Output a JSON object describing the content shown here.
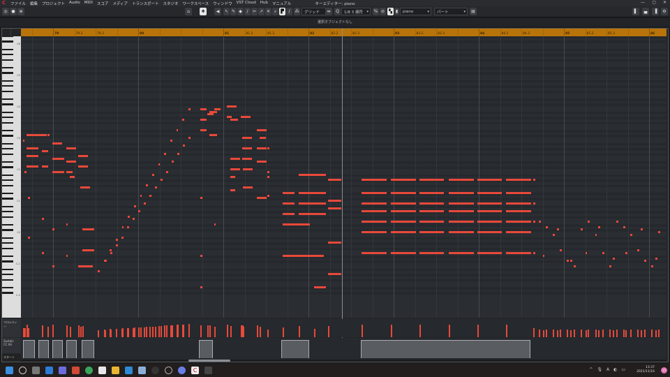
{
  "window": {
    "title": "キーエディター: piano",
    "status": "選択オブジェクトなし"
  },
  "menu": [
    "ファイル",
    "編集",
    "プロジェクト",
    "Audio",
    "MIDI",
    "スコア",
    "メディア",
    "トランスポート",
    "スタジオ",
    "ワークスペース",
    "ウィンドウ",
    "VST Cloud",
    "Hub",
    "マニュアル"
  ],
  "toolbar": {
    "snap_type": "グリッド",
    "quantize": "1/8  3 連符",
    "track": "piano",
    "part": "パート"
  },
  "ruler": [
    {
      "label": "79",
      "bar": 79,
      "beat": 1
    },
    {
      "label": "79.2",
      "bar": 79,
      "beat": 2
    },
    {
      "label": "79.3",
      "bar": 79,
      "beat": 3
    },
    {
      "label": "80",
      "bar": 80,
      "beat": 1
    },
    {
      "label": "81",
      "bar": 81,
      "beat": 1
    },
    {
      "label": "81.2",
      "bar": 81,
      "beat": 2
    },
    {
      "label": "81.3",
      "bar": 81,
      "beat": 3
    },
    {
      "label": "82",
      "bar": 82,
      "beat": 1
    },
    {
      "label": "82.2",
      "bar": 82,
      "beat": 2
    },
    {
      "label": "82.3",
      "bar": 82,
      "beat": 3
    },
    {
      "label": "83",
      "bar": 83,
      "beat": 1
    },
    {
      "label": "83.2",
      "bar": 83,
      "beat": 2
    },
    {
      "label": "83.3",
      "bar": 83,
      "beat": 3
    },
    {
      "label": "84",
      "bar": 84,
      "beat": 1
    },
    {
      "label": "84.2",
      "bar": 84,
      "beat": 2
    },
    {
      "label": "84.3",
      "bar": 84,
      "beat": 3
    },
    {
      "label": "85",
      "bar": 85,
      "beat": 1
    },
    {
      "label": "85.2",
      "bar": 85,
      "beat": 2
    },
    {
      "label": "85.3",
      "bar": 85,
      "beat": 3
    },
    {
      "label": "86",
      "bar": 86,
      "beat": 1
    }
  ],
  "lanes": {
    "velocity_label": "ベロシティー",
    "sustain_label": "Sustain",
    "sustain_cc": "CC 64",
    "start_label": "スタート"
  },
  "notes_format": "[start_beat_from_bar79, length_beats, midi_pitch, velocity]",
  "notes": [
    [
      -1.25,
      0.98,
      61,
      95
    ],
    [
      -0.26,
      0.13,
      61,
      80
    ],
    [
      -1.41,
      0.1,
      59,
      70
    ],
    [
      -1.25,
      0.59,
      56,
      90
    ],
    [
      -1.25,
      0.59,
      53,
      85
    ],
    [
      -1.25,
      0.59,
      49,
      85
    ],
    [
      -0.52,
      0.33,
      55,
      90
    ],
    [
      -0.52,
      0.33,
      49,
      80
    ],
    [
      -0.03,
      0.49,
      58,
      95
    ],
    [
      -0.03,
      0.59,
      52,
      90
    ],
    [
      -0.03,
      0.59,
      47,
      85
    ],
    [
      0.62,
      0.49,
      56,
      90
    ],
    [
      0.62,
      0.49,
      51,
      85
    ],
    [
      0.62,
      0.33,
      47,
      80
    ],
    [
      0.79,
      0.26,
      45,
      80
    ],
    [
      1.18,
      0.49,
      53,
      90
    ],
    [
      1.18,
      0.49,
      49,
      85
    ],
    [
      1.28,
      0.49,
      41,
      80
    ],
    [
      -1.34,
      0.1,
      47,
      70
    ],
    [
      -1.18,
      0.1,
      37,
      70
    ],
    [
      -1.18,
      0.1,
      22,
      70
    ],
    [
      -0.52,
      0.1,
      29,
      70
    ],
    [
      -0.52,
      0.1,
      16,
      70
    ],
    [
      -0.03,
      0.1,
      25,
      70
    ],
    [
      -0.03,
      0.1,
      11,
      70
    ],
    [
      0.62,
      0.1,
      27,
      70
    ],
    [
      0.62,
      0.1,
      15,
      70
    ],
    [
      1.18,
      0.72,
      11,
      80
    ],
    [
      1.38,
      0.59,
      25,
      85
    ],
    [
      1.38,
      0.59,
      17,
      85
    ],
    [
      2.1,
      0.12,
      9,
      55
    ],
    [
      2.38,
      0.12,
      13,
      58
    ],
    [
      2.67,
      0.12,
      17,
      61
    ],
    [
      2.95,
      0.12,
      21,
      64
    ],
    [
      3.24,
      0.12,
      26,
      67
    ],
    [
      3.52,
      0.12,
      30,
      70
    ],
    [
      3.8,
      0.12,
      34,
      73
    ],
    [
      4.09,
      0.12,
      38,
      76
    ],
    [
      4.37,
      0.12,
      42,
      79
    ],
    [
      4.66,
      0.12,
      46,
      82
    ],
    [
      4.94,
      0.12,
      50,
      85
    ],
    [
      5.22,
      0.12,
      54,
      88
    ],
    [
      5.51,
      0.12,
      59,
      91
    ],
    [
      5.79,
      0.12,
      63,
      94
    ],
    [
      6.08,
      0.12,
      67,
      97
    ],
    [
      6.36,
      0.12,
      71,
      100
    ],
    [
      2.43,
      0.12,
      13,
      55
    ],
    [
      2.69,
      0.12,
      16,
      58
    ],
    [
      2.95,
      0.12,
      19,
      61
    ],
    [
      3.22,
      0.12,
      22,
      64
    ],
    [
      3.48,
      0.12,
      26,
      67
    ],
    [
      3.74,
      0.12,
      29,
      70
    ],
    [
      4.0,
      0.12,
      32,
      73
    ],
    [
      4.26,
      0.12,
      35,
      76
    ],
    [
      4.53,
      0.12,
      38,
      79
    ],
    [
      4.79,
      0.12,
      41,
      82
    ],
    [
      5.05,
      0.12,
      44,
      85
    ],
    [
      5.31,
      0.12,
      47,
      88
    ],
    [
      5.57,
      0.12,
      51,
      91
    ],
    [
      5.84,
      0.12,
      54,
      94
    ],
    [
      6.1,
      0.12,
      57,
      97
    ],
    [
      6.36,
      0.12,
      60,
      100
    ],
    [
      6.92,
      0.33,
      71,
      90
    ],
    [
      7.25,
      0.33,
      69,
      88
    ],
    [
      6.92,
      0.33,
      67,
      85
    ],
    [
      7.34,
      0.39,
      70,
      88
    ],
    [
      6.92,
      0.33,
      63,
      85
    ],
    [
      7.34,
      0.39,
      61,
      85
    ],
    [
      7.57,
      0.33,
      71,
      80
    ],
    [
      8.16,
      0.49,
      72,
      95
    ],
    [
      8.16,
      0.26,
      68,
      80
    ],
    [
      8.33,
      0.39,
      67,
      85
    ],
    [
      8.82,
      0.49,
      68,
      90
    ],
    [
      8.89,
      0.49,
      60,
      90
    ],
    [
      8.89,
      0.49,
      56,
      88
    ],
    [
      8.89,
      0.49,
      52,
      88
    ],
    [
      8.33,
      0.49,
      52,
      85
    ],
    [
      8.33,
      0.49,
      48,
      85
    ],
    [
      8.92,
      0.49,
      48,
      80
    ],
    [
      8.92,
      0.49,
      41,
      80
    ],
    [
      9.57,
      0.49,
      63,
      90
    ],
    [
      9.57,
      0.49,
      56,
      88
    ],
    [
      9.57,
      0.49,
      51,
      85
    ],
    [
      9.57,
      0.49,
      37,
      80
    ],
    [
      8.33,
      0.26,
      45,
      75
    ],
    [
      8.33,
      0.26,
      40,
      75
    ],
    [
      9.7,
      0.33,
      60,
      80
    ],
    [
      6.92,
      0.1,
      37,
      60
    ],
    [
      7.57,
      0.1,
      27,
      60
    ],
    [
      6.92,
      0.1,
      15,
      60
    ],
    [
      6.92,
      0.1,
      3,
      60
    ],
    [
      10.07,
      0.1,
      56,
      60
    ],
    [
      10.07,
      0.1,
      47,
      60
    ],
    [
      10.07,
      0.1,
      45,
      60
    ],
    [
      10.07,
      0.1,
      38,
      60
    ],
    [
      10.79,
      0.59,
      39,
      70
    ],
    [
      10.79,
      0.59,
      35,
      70
    ],
    [
      10.79,
      0.59,
      31,
      70
    ],
    [
      10.79,
      1.31,
      27,
      75
    ],
    [
      10.79,
      1.97,
      15,
      75
    ],
    [
      11.54,
      1.31,
      46,
      85
    ],
    [
      11.54,
      1.31,
      39,
      80
    ],
    [
      11.54,
      1.31,
      35,
      80
    ],
    [
      11.54,
      1.31,
      31,
      80
    ],
    [
      12.92,
      0.66,
      44,
      85
    ],
    [
      12.92,
      0.66,
      36,
      80
    ],
    [
      12.92,
      0.66,
      33,
      78
    ],
    [
      12.92,
      0.66,
      20,
      75
    ],
    [
      12.92,
      0.66,
      8,
      75
    ],
    [
      12.26,
      0.59,
      3,
      65
    ],
    [
      14.49,
      1.2,
      44,
      95
    ],
    [
      14.49,
      1.2,
      39,
      93
    ],
    [
      14.49,
      1.2,
      35,
      92
    ],
    [
      14.49,
      1.2,
      32,
      91
    ],
    [
      14.49,
      1.2,
      28,
      90
    ],
    [
      14.49,
      1.2,
      24,
      88
    ],
    [
      14.49,
      1.2,
      16,
      85
    ],
    [
      15.87,
      1.2,
      44,
      95
    ],
    [
      15.87,
      1.2,
      39,
      93
    ],
    [
      15.87,
      1.2,
      35,
      92
    ],
    [
      15.87,
      1.2,
      32,
      91
    ],
    [
      15.87,
      1.2,
      28,
      90
    ],
    [
      15.87,
      1.2,
      24,
      88
    ],
    [
      15.87,
      1.2,
      16,
      85
    ],
    [
      17.21,
      1.2,
      44,
      95
    ],
    [
      17.21,
      1.2,
      39,
      93
    ],
    [
      17.21,
      1.2,
      35,
      92
    ],
    [
      17.21,
      1.2,
      32,
      91
    ],
    [
      17.21,
      1.2,
      28,
      90
    ],
    [
      17.21,
      1.2,
      24,
      88
    ],
    [
      17.21,
      1.2,
      16,
      85
    ],
    [
      18.59,
      1.2,
      44,
      95
    ],
    [
      18.59,
      1.2,
      39,
      93
    ],
    [
      18.59,
      1.2,
      35,
      92
    ],
    [
      18.59,
      1.2,
      32,
      91
    ],
    [
      18.59,
      1.2,
      28,
      90
    ],
    [
      18.59,
      1.2,
      24,
      88
    ],
    [
      18.59,
      1.2,
      16,
      85
    ],
    [
      19.93,
      1.2,
      44,
      95
    ],
    [
      19.93,
      1.2,
      39,
      93
    ],
    [
      19.93,
      1.2,
      35,
      92
    ],
    [
      19.93,
      1.2,
      32,
      91
    ],
    [
      19.93,
      1.2,
      28,
      90
    ],
    [
      19.93,
      1.2,
      24,
      88
    ],
    [
      19.93,
      1.2,
      16,
      85
    ],
    [
      21.28,
      1.2,
      44,
      95
    ],
    [
      21.28,
      1.2,
      39,
      93
    ],
    [
      21.28,
      1.2,
      35,
      92
    ],
    [
      21.28,
      1.2,
      32,
      91
    ],
    [
      21.28,
      1.2,
      28,
      90
    ],
    [
      21.28,
      1.2,
      24,
      88
    ],
    [
      21.28,
      1.2,
      16,
      85
    ],
    [
      22.56,
      0.13,
      44,
      70
    ],
    [
      22.56,
      0.13,
      35,
      70
    ],
    [
      22.56,
      0.13,
      28,
      70
    ],
    [
      22.56,
      0.13,
      16,
      70
    ],
    [
      22.82,
      0.13,
      28,
      60
    ],
    [
      23.15,
      0.13,
      26,
      60
    ],
    [
      23.48,
      0.13,
      23,
      60
    ],
    [
      23.81,
      0.13,
      17,
      60
    ],
    [
      24.14,
      0.13,
      13,
      60
    ],
    [
      24.47,
      0.13,
      11,
      60
    ],
    [
      24.8,
      0.13,
      25,
      60
    ],
    [
      25.13,
      0.13,
      28,
      60
    ],
    [
      25.46,
      0.13,
      23,
      60
    ],
    [
      25.79,
      0.13,
      16,
      60
    ],
    [
      26.12,
      0.13,
      11,
      60
    ],
    [
      26.45,
      0.13,
      28,
      60
    ],
    [
      26.78,
      0.13,
      26,
      60
    ],
    [
      27.11,
      0.13,
      23,
      60
    ],
    [
      27.44,
      0.13,
      17,
      60
    ],
    [
      27.77,
      0.13,
      13,
      60
    ],
    [
      28.1,
      0.13,
      11,
      60
    ],
    [
      28.43,
      0.13,
      24,
      60
    ],
    [
      23.0,
      0.13,
      15,
      55
    ],
    [
      23.66,
      0.13,
      25,
      55
    ],
    [
      24.3,
      0.13,
      13,
      55
    ],
    [
      25.0,
      0.13,
      16,
      55
    ],
    [
      25.6,
      0.13,
      26,
      55
    ],
    [
      26.3,
      0.13,
      14,
      55
    ],
    [
      26.9,
      0.13,
      16,
      55
    ],
    [
      27.6,
      0.13,
      25,
      55
    ],
    [
      28.3,
      0.13,
      14,
      55
    ]
  ],
  "sustain": [
    [
      -1.41,
      -0.85
    ],
    [
      -0.69,
      -0.2
    ],
    [
      -0.03,
      0.46
    ],
    [
      0.62,
      1.11
    ],
    [
      1.34,
      1.93
    ],
    [
      6.85,
      7.51
    ],
    [
      10.72,
      12.03
    ],
    [
      14.46,
      22.43
    ]
  ],
  "taskbar": {
    "time": "13:37",
    "date": "2021/11/16",
    "notifications": "15"
  },
  "colors": {
    "note": "#e8493a",
    "ruler": "#b8740a"
  }
}
